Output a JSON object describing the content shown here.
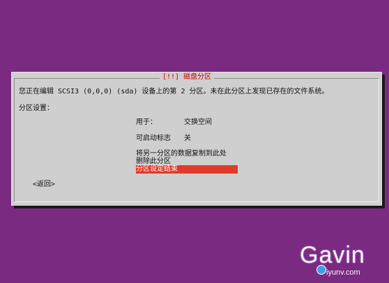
{
  "dialog": {
    "title": "[!!] 磁盘分区",
    "description": "您正在编辑 SCSI3 (0,0,0) (sda) 设备上的第 2 分区。未在此分区上发现已存在的文件系统。",
    "settings_label": "分区设置："
  },
  "options": [
    {
      "label": "用于：",
      "value": "交换空间"
    },
    {
      "label": "可启动标志",
      "value": "关"
    }
  ],
  "menu": [
    {
      "label": "将另一分区的数据复制到此处"
    },
    {
      "label": "删除此分区"
    },
    {
      "label": "分区设定结束"
    }
  ],
  "selected_menu_index": 2,
  "back_button": "<返回>",
  "watermark": {
    "brand": "Gavin",
    "domain": "iyunv.com"
  },
  "colors": {
    "background": "#7a2a80",
    "dialog": "#cfcfcf",
    "title": "#d10000",
    "selection": "#e03a2b"
  }
}
